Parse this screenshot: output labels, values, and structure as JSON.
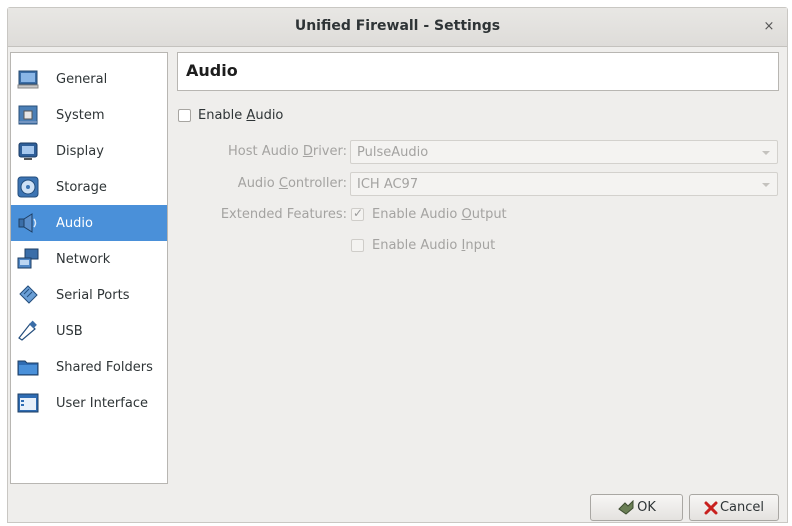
{
  "window": {
    "title": "Unified Firewall - Settings",
    "close_glyph": "×"
  },
  "sidebar": {
    "items": [
      {
        "label": "General",
        "icon": "monitor-icon"
      },
      {
        "label": "System",
        "icon": "chip-icon"
      },
      {
        "label": "Display",
        "icon": "display-icon"
      },
      {
        "label": "Storage",
        "icon": "disc-icon"
      },
      {
        "label": "Audio",
        "icon": "speaker-icon",
        "selected": true
      },
      {
        "label": "Network",
        "icon": "network-icon"
      },
      {
        "label": "Serial Ports",
        "icon": "serial-port-icon"
      },
      {
        "label": "USB",
        "icon": "usb-icon"
      },
      {
        "label": "Shared Folders",
        "icon": "folder-icon"
      },
      {
        "label": "User Interface",
        "icon": "window-icon"
      }
    ]
  },
  "page": {
    "title": "Audio"
  },
  "enable_audio": {
    "label_pre": "Enable ",
    "label_mnemonic": "A",
    "label_post": "udio",
    "checked": false
  },
  "host_driver": {
    "label_pre": "Host Audio ",
    "label_mnemonic": "D",
    "label_post": "river:",
    "value": "PulseAudio"
  },
  "controller": {
    "label_pre": "Audio ",
    "label_mnemonic": "C",
    "label_post": "ontroller:",
    "value": "ICH AC97"
  },
  "extended": {
    "label": "Extended Features:",
    "output": {
      "pre": "Enable Audio ",
      "mnemonic": "O",
      "post": "utput",
      "checked": true
    },
    "input": {
      "pre": "Enable Audio ",
      "mnemonic": "I",
      "post": "nput",
      "checked": false
    }
  },
  "buttons": {
    "ok_label": "OK",
    "cancel_label": "Cancel"
  },
  "colors": {
    "selection": "#4a90d9",
    "disabled_text": "#a4a3a1"
  }
}
